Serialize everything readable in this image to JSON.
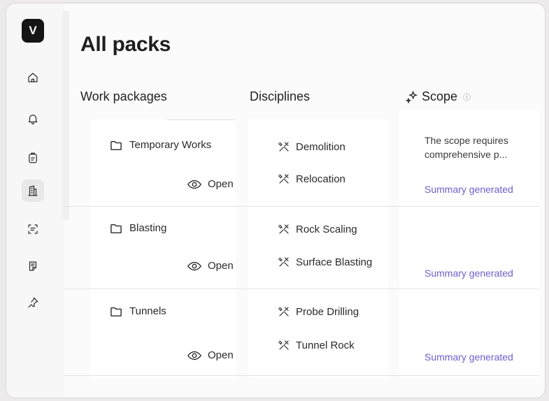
{
  "sidebar": {
    "logo_letter": "V",
    "items": [
      {
        "icon": "home-icon"
      },
      {
        "icon": "bell-icon"
      },
      {
        "icon": "clipboard-icon"
      },
      {
        "icon": "building-icon",
        "active": true
      },
      {
        "icon": "scan-text-icon"
      },
      {
        "icon": "notes-icon"
      },
      {
        "icon": "pin-icon"
      }
    ]
  },
  "page": {
    "title": "All packs"
  },
  "columns": {
    "work_packages": "Work packages",
    "disciplines": "Disciplines",
    "scope": "Scope",
    "scope_info": "ⓘ"
  },
  "rows": [
    {
      "package": "Temporary Works",
      "open_label": "Open",
      "disciplines": [
        "Demolition",
        "Relocation"
      ],
      "scope_text": "The scope requires comprehensive p...",
      "summary_label": "Summary generated"
    },
    {
      "package": "Blasting",
      "open_label": "Open",
      "disciplines": [
        "Rock Scaling",
        "Surface Blasting"
      ],
      "scope_text": "",
      "summary_label": "Summary generated"
    },
    {
      "package": "Tunnels",
      "open_label": "Open",
      "disciplines": [
        "Probe Drilling",
        "Tunnel Rock"
      ],
      "scope_text": "",
      "summary_label": "Summary generated"
    }
  ],
  "colors": {
    "accent": "#6b5fcf",
    "logo_bg": "#151515"
  }
}
